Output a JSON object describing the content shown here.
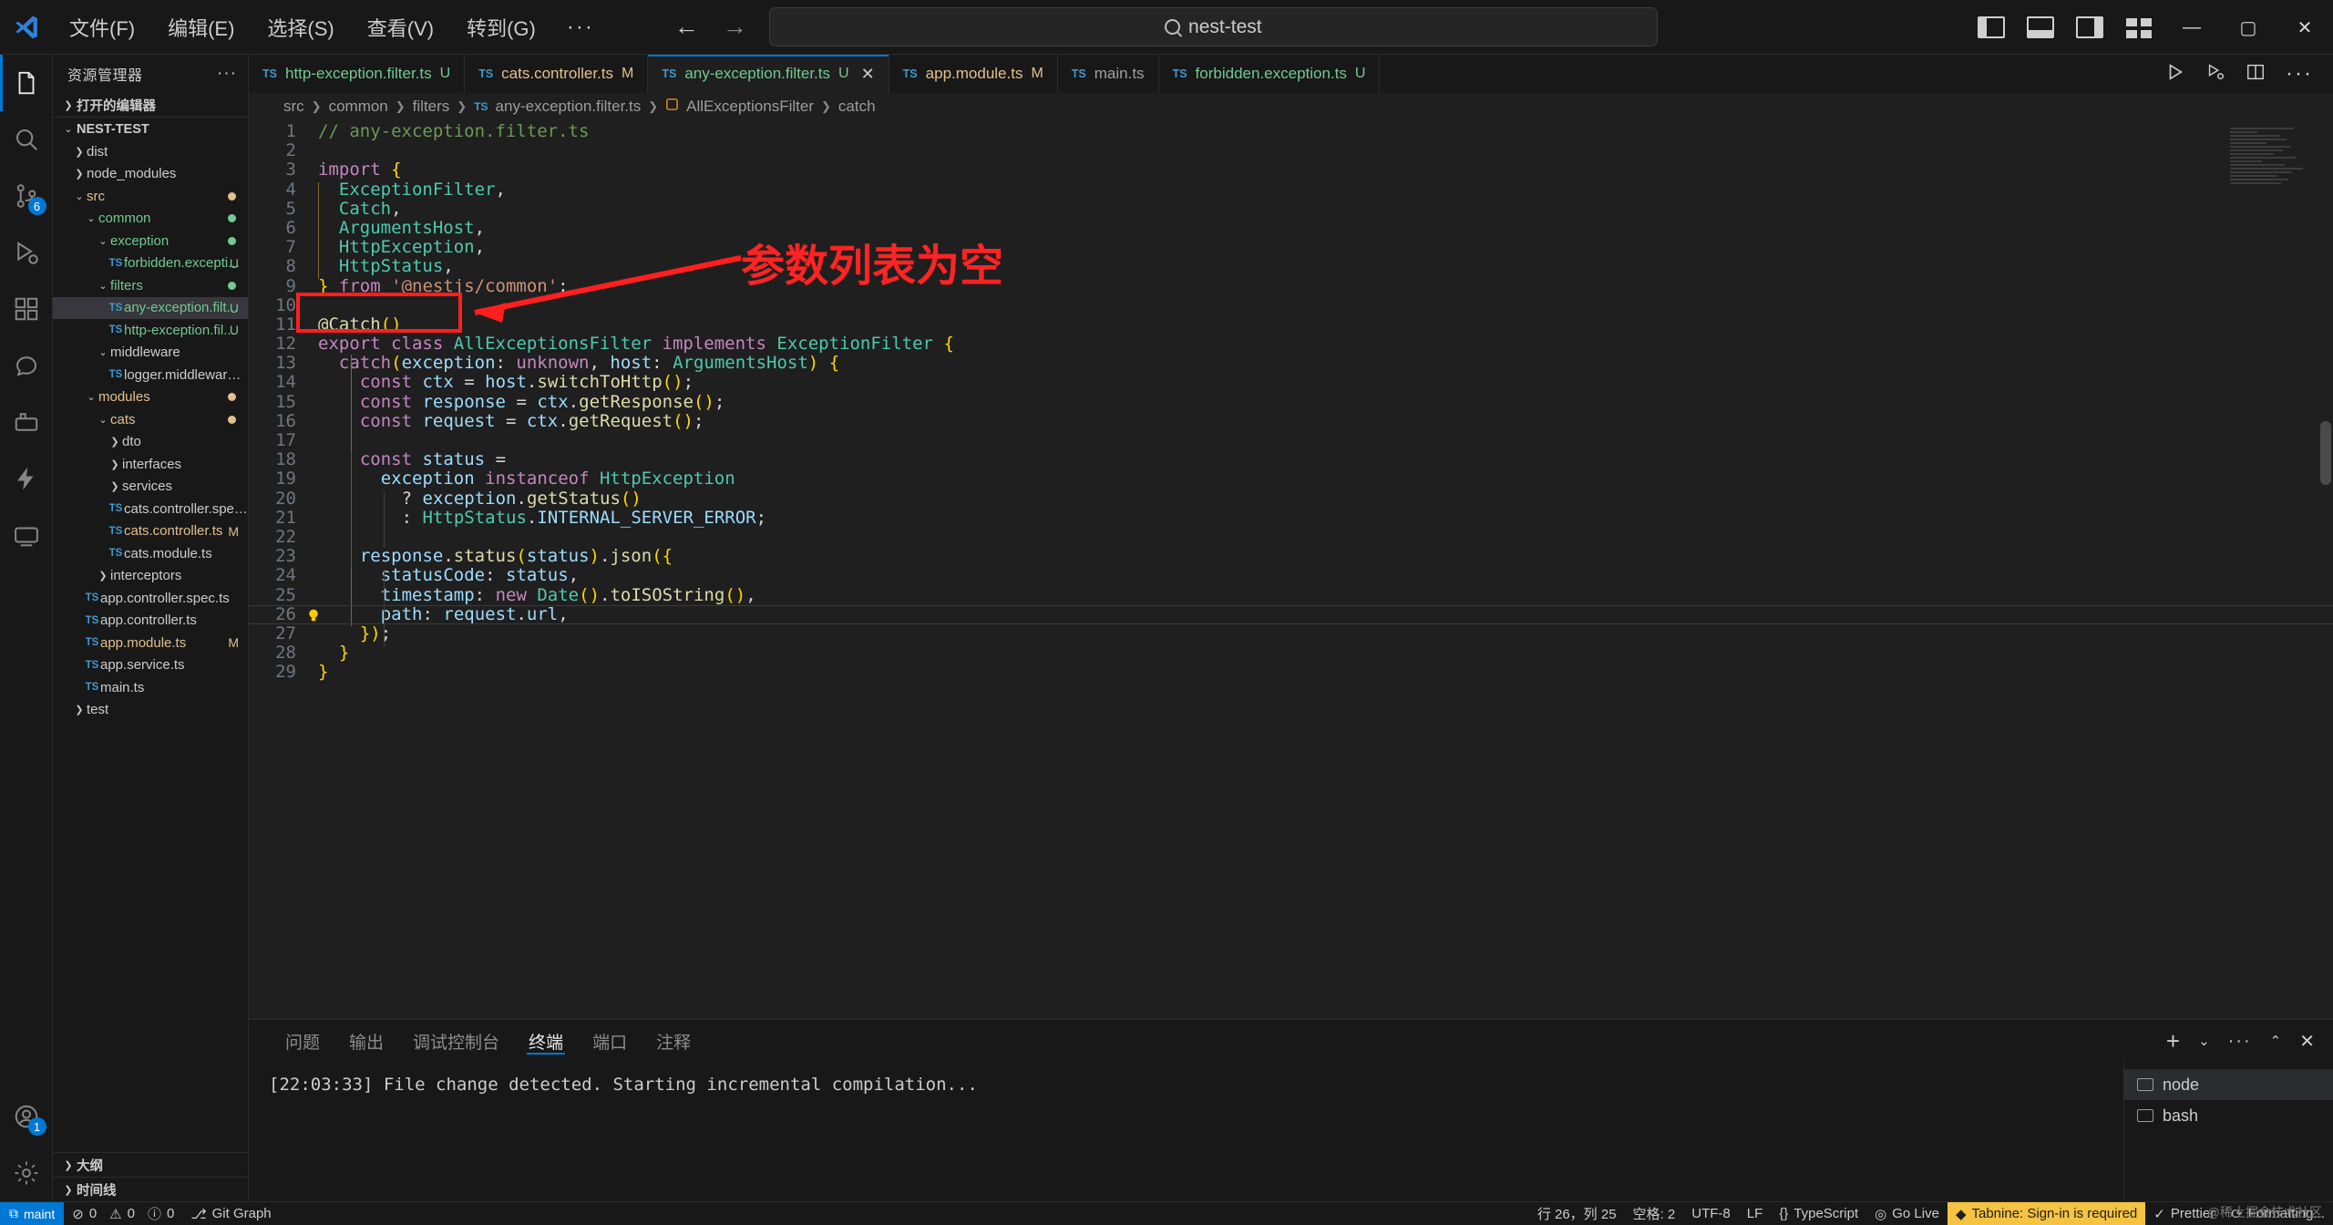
{
  "titlebar": {
    "logo_icon": "vscode-logo-icon",
    "menus": [
      "文件(F)",
      "编辑(E)",
      "选择(S)",
      "查看(V)",
      "转到(G)"
    ],
    "more_label": "···",
    "back_icon": "arrow-left-icon",
    "forward_icon": "arrow-right-icon",
    "command_center": {
      "text": "nest-test",
      "search_icon": "search-icon"
    },
    "layout_icons": [
      "toggle-primary-sidebar-icon",
      "toggle-panel-icon",
      "toggle-secondary-sidebar-icon",
      "customize-layout-icon"
    ],
    "window_minimize": "—",
    "window_maximize": "▢",
    "window_close": "✕"
  },
  "activitybar": {
    "items": [
      {
        "name": "explorer",
        "icon": "files-icon",
        "selected": true,
        "badge": ""
      },
      {
        "name": "search",
        "icon": "search-icon",
        "selected": false,
        "badge": ""
      },
      {
        "name": "source-control",
        "icon": "source-control-icon",
        "selected": false,
        "badge": "6"
      },
      {
        "name": "run-and-debug",
        "icon": "debug-icon",
        "selected": false,
        "badge": ""
      },
      {
        "name": "extensions",
        "icon": "extensions-icon",
        "selected": false,
        "badge": ""
      },
      {
        "name": "copilot-chat",
        "icon": "copilot-icon",
        "selected": false,
        "badge": ""
      },
      {
        "name": "docker",
        "icon": "docker-icon",
        "selected": false,
        "badge": ""
      },
      {
        "name": "thunder-client",
        "icon": "thunder-icon",
        "selected": false,
        "badge": ""
      },
      {
        "name": "remote-explorer",
        "icon": "remote-icon",
        "selected": false,
        "badge": ""
      }
    ],
    "bottom": [
      {
        "name": "accounts",
        "icon": "account-icon",
        "badge": "1"
      },
      {
        "name": "settings",
        "icon": "gear-icon",
        "badge": ""
      }
    ]
  },
  "sidebar": {
    "title": "资源管理器",
    "more_actions": "···",
    "open_editors_label": "打开的编辑器",
    "project_label": "NEST-TEST",
    "outline_label": "大纲",
    "timeline_label": "时间线",
    "tree": [
      {
        "label": "dist",
        "indent": 1,
        "type": "folder",
        "open": false,
        "color": "#cccccc",
        "status": "",
        "dot": ""
      },
      {
        "label": "node_modules",
        "indent": 1,
        "type": "folder",
        "open": false,
        "color": "#cccccc",
        "status": "",
        "dot": ""
      },
      {
        "label": "src",
        "indent": 1,
        "type": "folder",
        "open": true,
        "color": "#e2c08d",
        "status": "",
        "dot": "#e2c08d"
      },
      {
        "label": "common",
        "indent": 2,
        "type": "folder",
        "open": true,
        "color": "#73c991",
        "status": "",
        "dot": "#73c991"
      },
      {
        "label": "exception",
        "indent": 3,
        "type": "folder",
        "open": true,
        "color": "#73c991",
        "status": "",
        "dot": "#73c991"
      },
      {
        "label": "forbidden.excepti...",
        "indent": 4,
        "type": "file",
        "open": false,
        "color": "#73c991",
        "status": "U",
        "dot": ""
      },
      {
        "label": "filters",
        "indent": 3,
        "type": "folder",
        "open": true,
        "color": "#73c991",
        "status": "",
        "dot": "#73c991"
      },
      {
        "label": "any-exception.filt...",
        "indent": 4,
        "type": "file",
        "open": false,
        "color": "#73c991",
        "status": "U",
        "dot": "",
        "selected": true
      },
      {
        "label": "http-exception.fil...",
        "indent": 4,
        "type": "file",
        "open": false,
        "color": "#73c991",
        "status": "U",
        "dot": ""
      },
      {
        "label": "middleware",
        "indent": 3,
        "type": "folder",
        "open": true,
        "color": "#cccccc",
        "status": "",
        "dot": ""
      },
      {
        "label": "logger.middleware.ts",
        "indent": 4,
        "type": "file",
        "open": false,
        "color": "#cccccc",
        "status": "",
        "dot": ""
      },
      {
        "label": "modules",
        "indent": 2,
        "type": "folder",
        "open": true,
        "color": "#e2c08d",
        "status": "",
        "dot": "#e2c08d"
      },
      {
        "label": "cats",
        "indent": 3,
        "type": "folder",
        "open": true,
        "color": "#e2c08d",
        "status": "",
        "dot": "#e2c08d"
      },
      {
        "label": "dto",
        "indent": 4,
        "type": "folder",
        "open": false,
        "color": "#cccccc",
        "status": "",
        "dot": ""
      },
      {
        "label": "interfaces",
        "indent": 4,
        "type": "folder",
        "open": false,
        "color": "#cccccc",
        "status": "",
        "dot": ""
      },
      {
        "label": "services",
        "indent": 4,
        "type": "folder",
        "open": false,
        "color": "#cccccc",
        "status": "",
        "dot": ""
      },
      {
        "label": "cats.controller.spec.ts",
        "indent": 4,
        "type": "file",
        "open": false,
        "color": "#cccccc",
        "status": "",
        "dot": ""
      },
      {
        "label": "cats.controller.ts",
        "indent": 4,
        "type": "file",
        "open": false,
        "color": "#e2c08d",
        "status": "M",
        "dot": ""
      },
      {
        "label": "cats.module.ts",
        "indent": 4,
        "type": "file",
        "open": false,
        "color": "#cccccc",
        "status": "",
        "dot": ""
      },
      {
        "label": "interceptors",
        "indent": 3,
        "type": "folder",
        "open": false,
        "color": "#cccccc",
        "status": "",
        "dot": ""
      },
      {
        "label": "app.controller.spec.ts",
        "indent": 2,
        "type": "file",
        "open": false,
        "color": "#cccccc",
        "status": "",
        "dot": ""
      },
      {
        "label": "app.controller.ts",
        "indent": 2,
        "type": "file",
        "open": false,
        "color": "#cccccc",
        "status": "",
        "dot": ""
      },
      {
        "label": "app.module.ts",
        "indent": 2,
        "type": "file",
        "open": false,
        "color": "#e2c08d",
        "status": "M",
        "dot": ""
      },
      {
        "label": "app.service.ts",
        "indent": 2,
        "type": "file",
        "open": false,
        "color": "#cccccc",
        "status": "",
        "dot": ""
      },
      {
        "label": "main.ts",
        "indent": 2,
        "type": "file",
        "open": false,
        "color": "#cccccc",
        "status": "",
        "dot": ""
      },
      {
        "label": "test",
        "indent": 1,
        "type": "folder",
        "open": false,
        "color": "#cccccc",
        "status": "",
        "dot": ""
      }
    ]
  },
  "tabs": [
    {
      "name": "http-exception.filter.ts",
      "icon": "ts-icon",
      "status": "U",
      "color": "#73c991",
      "active": false
    },
    {
      "name": "cats.controller.ts",
      "icon": "ts-icon",
      "status": "M",
      "color": "#e2c08d",
      "active": false
    },
    {
      "name": "any-exception.filter.ts",
      "icon": "ts-icon",
      "status": "U",
      "color": "#73c991",
      "active": true,
      "close_icon": "close-icon"
    },
    {
      "name": "app.module.ts",
      "icon": "ts-icon",
      "status": "M",
      "color": "#e2c08d",
      "active": false
    },
    {
      "name": "main.ts",
      "icon": "ts-icon",
      "status": "",
      "color": "#a0a0a0",
      "active": false
    },
    {
      "name": "forbidden.exception.ts",
      "icon": "ts-icon",
      "status": "U",
      "color": "#73c991",
      "active": false
    }
  ],
  "tab_actions": [
    "run-icon",
    "run-and-debug-icon",
    "split-editor-icon",
    "more-actions-icon"
  ],
  "breadcrumb": [
    "src",
    "common",
    "filters",
    "any-exception.filter.ts",
    "AllExceptionsFilter",
    "catch"
  ],
  "code": {
    "language": "typescript",
    "first_line": 1,
    "current_line": 26,
    "lines": [
      "// any-exception.filter.ts",
      "",
      "import {",
      "  ExceptionFilter,",
      "  Catch,",
      "  ArgumentsHost,",
      "  HttpException,",
      "  HttpStatus,",
      "} from '@nestjs/common';",
      "",
      "@Catch()",
      "export class AllExceptionsFilter implements ExceptionFilter {",
      "  catch(exception: unknown, host: ArgumentsHost) {",
      "    const ctx = host.switchToHttp();",
      "    const response = ctx.getResponse();",
      "    const request = ctx.getRequest();",
      "",
      "    const status =",
      "      exception instanceof HttpException",
      "        ? exception.getStatus()",
      "        : HttpStatus.INTERNAL_SERVER_ERROR;",
      "",
      "    response.status(status).json({",
      "      statusCode: status,",
      "      timestamp: new Date().toISOString(),",
      "      path: request.url,",
      "    });",
      "  }",
      "}"
    ]
  },
  "annotation": {
    "text": "参数列表为空",
    "color": "#ff2323",
    "highlight_box_label": "@Catch()"
  },
  "panel": {
    "tabs": [
      "问题",
      "输出",
      "调试控制台",
      "终端",
      "端口",
      "注释"
    ],
    "active_tab": "终端",
    "actions": [
      "add-terminal-icon",
      "split-terminal-dropdown-icon",
      "more-actions-icon",
      "maximize-panel-icon",
      "close-panel-icon"
    ],
    "terminal_output": "[22:03:33] File change detected. Starting incremental compilation...",
    "terminal_list": [
      {
        "label": "node",
        "icon": "terminal-icon",
        "active": true
      },
      {
        "label": "bash",
        "icon": "terminal-icon",
        "active": false
      }
    ]
  },
  "statusbar": {
    "remote_label": "maint",
    "remote_icon": "remote-indicator-icon",
    "left": [
      {
        "label": "0",
        "icon": "error-icon"
      },
      {
        "label": "0",
        "icon": "warning-icon"
      },
      {
        "label": "0",
        "icon": "info-icon"
      },
      {
        "label": "Git Graph",
        "icon": "git-graph-icon"
      }
    ],
    "right": [
      {
        "label": "行 26，列 25",
        "icon": ""
      },
      {
        "label": "空格: 2",
        "icon": ""
      },
      {
        "label": "UTF-8",
        "icon": ""
      },
      {
        "label": "LF",
        "icon": ""
      },
      {
        "label": "TypeScript",
        "icon": "braces-icon"
      },
      {
        "label": "Go Live",
        "icon": "broadcast-icon"
      },
      {
        "label": "Tabnine: Sign-in is required",
        "icon": "tabnine-icon",
        "warn": true
      },
      {
        "label": "Prettier",
        "icon": "check-icon"
      },
      {
        "label": "Formatting...",
        "icon": "sync-icon"
      }
    ],
    "watermark": "@稀土掘金技术社区"
  }
}
